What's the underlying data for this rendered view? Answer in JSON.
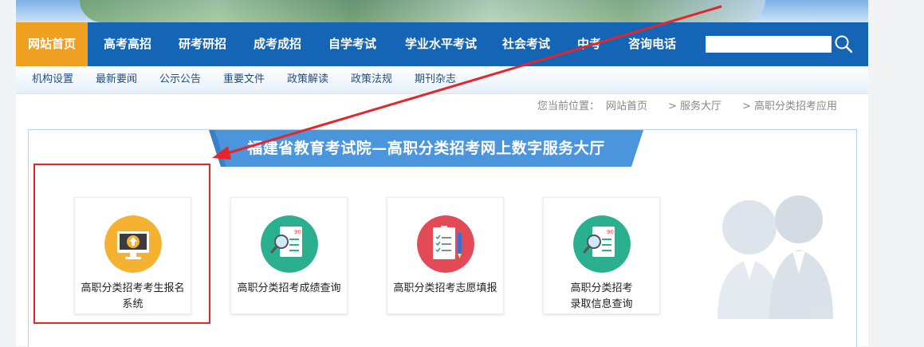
{
  "main_nav": {
    "items": [
      "网站首页",
      "高考高招",
      "研考研招",
      "成考成招",
      "自学考试",
      "学业水平考试",
      "社会考试",
      "中考",
      "咨询电话"
    ],
    "active_index": 0,
    "search_placeholder": ""
  },
  "sub_nav": {
    "items": [
      "机构设置",
      "最新要闻",
      "公示公告",
      "重要文件",
      "政策解读",
      "政策法规",
      "期刊杂志"
    ]
  },
  "breadcrumb": {
    "prefix": "您当前位置：",
    "items": [
      "网站首页",
      ">  服务大厅",
      ">  高职分类招考应用"
    ]
  },
  "page_title": "福建省教育考试院—高职分类招考网上数字服务大厅",
  "cards": [
    {
      "label": "高职分类招考考生报名\n系统",
      "icon": "monitor-upload-icon",
      "color": "#f5b230"
    },
    {
      "label": "高职分类招考成绩查询",
      "icon": "score-report-search-icon",
      "color": "#2ab08f"
    },
    {
      "label": "高职分类招考志愿填报",
      "icon": "form-pencil-icon",
      "color": "#e24b55"
    },
    {
      "label": "高职分类招考\n录取信息查询",
      "icon": "admission-report-search-icon",
      "color": "#2ab08f"
    }
  ],
  "colors": {
    "nav_bg": "#1565b6",
    "nav_active": "#f0a020",
    "ribbon": "#4a95dc",
    "highlight": "#e3262a"
  }
}
